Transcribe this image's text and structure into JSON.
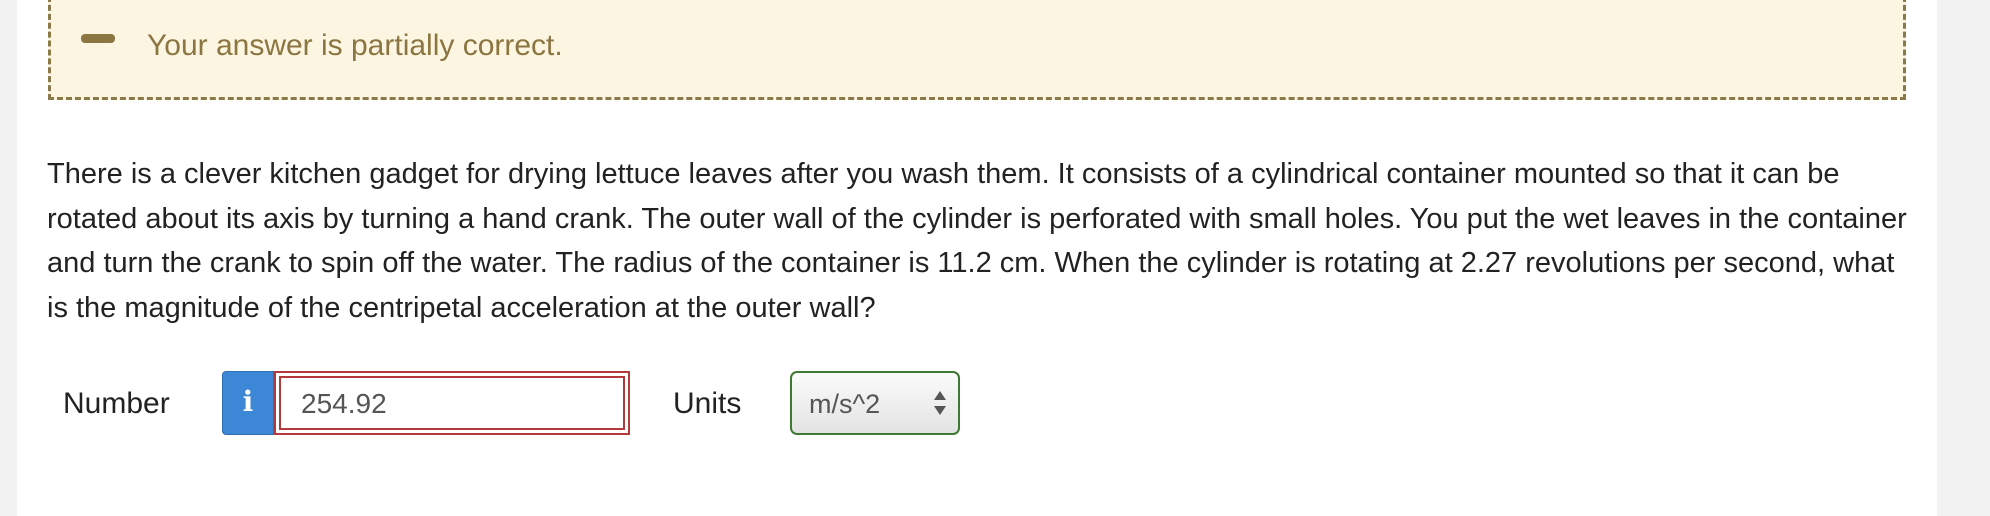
{
  "feedback": {
    "message": "Your answer is partially correct.",
    "icon": "minus-icon"
  },
  "question": {
    "text": "There is a clever kitchen gadget for drying lettuce leaves after you wash them. It consists of a cylindrical container mounted so that it can be rotated about its axis by turning a hand crank. The outer wall of the cylinder is perforated with small holes. You put the wet leaves in the container and turn the crank to spin off the water. The radius of the container is 11.2 cm. When the cylinder is rotating at 2.27 revolutions per second, what is the magnitude of the centripetal acceleration at the outer wall?"
  },
  "answer": {
    "number_label": "Number",
    "number_value": "254.92",
    "units_label": "Units",
    "units_value": "m/s^2",
    "info_icon": "info-icon"
  },
  "colors": {
    "feedback_bg": "#fcf5e1",
    "feedback_text": "#8b7540",
    "info_button": "#3d88d6",
    "input_error_border": "#b33a3a",
    "select_border": "#3f7a32"
  }
}
